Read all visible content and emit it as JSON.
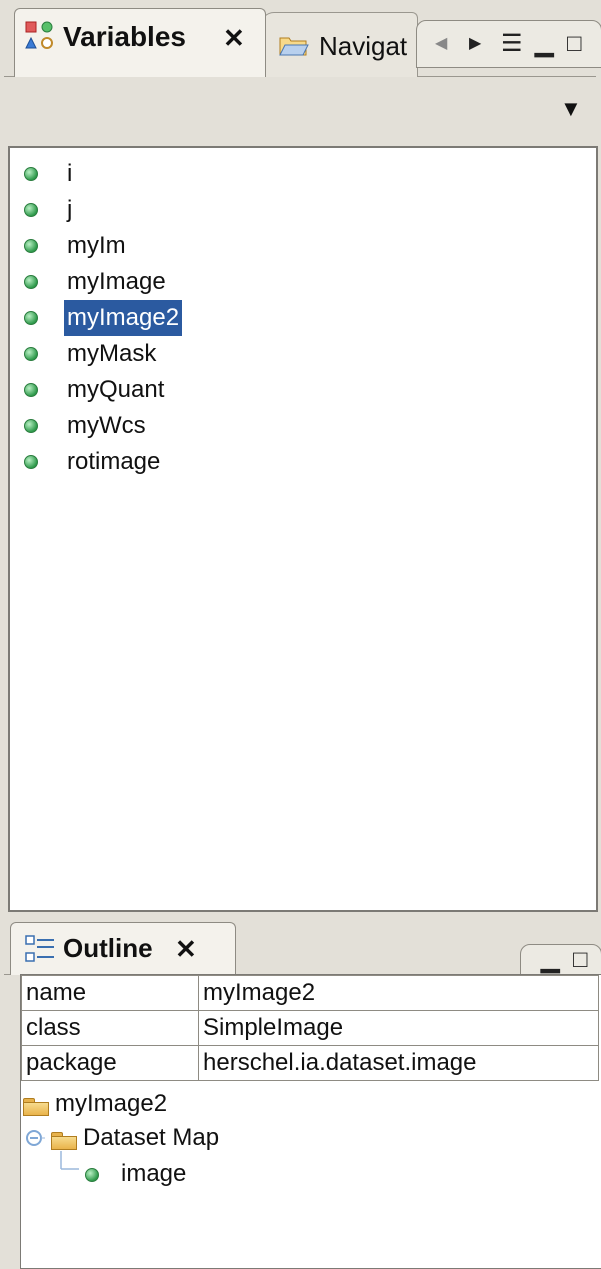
{
  "variables_view": {
    "tab_title": "Variables",
    "close_glyph": "✕",
    "tab_icon": "variables-icon",
    "other_tab_title": "Navigat",
    "other_tab_icon": "folder-icon",
    "controls": [
      "chevron-left-icon",
      "chevron-right-icon",
      "view-menu-icon",
      "minimize-icon",
      "maximize-icon"
    ],
    "control_glyphs": {
      "left": "◀",
      "right": "▶",
      "menu": "☰",
      "min": "▁",
      "max": "□",
      "dropdown": "▼"
    },
    "variables": [
      {
        "name": "i",
        "selected": false
      },
      {
        "name": "j",
        "selected": false
      },
      {
        "name": "myIm",
        "selected": false
      },
      {
        "name": "myImage",
        "selected": false
      },
      {
        "name": "myImage2",
        "selected": true
      },
      {
        "name": "myMask",
        "selected": false
      },
      {
        "name": "myQuant",
        "selected": false
      },
      {
        "name": "myWcs",
        "selected": false
      },
      {
        "name": "rotimage",
        "selected": false
      }
    ]
  },
  "outline_view": {
    "tab_title": "Outline",
    "close_glyph": "✕",
    "properties": [
      {
        "key": "name",
        "value": "myImage2"
      },
      {
        "key": "class",
        "value": "SimpleImage"
      },
      {
        "key": "package",
        "value": "herschel.ia.dataset.image"
      }
    ],
    "tree": {
      "root": "myImage2",
      "child": "Dataset Map",
      "leaf": "image"
    }
  },
  "colors": {
    "selection": "#2b5aa0",
    "variable_dot": "#2f9a4c"
  }
}
